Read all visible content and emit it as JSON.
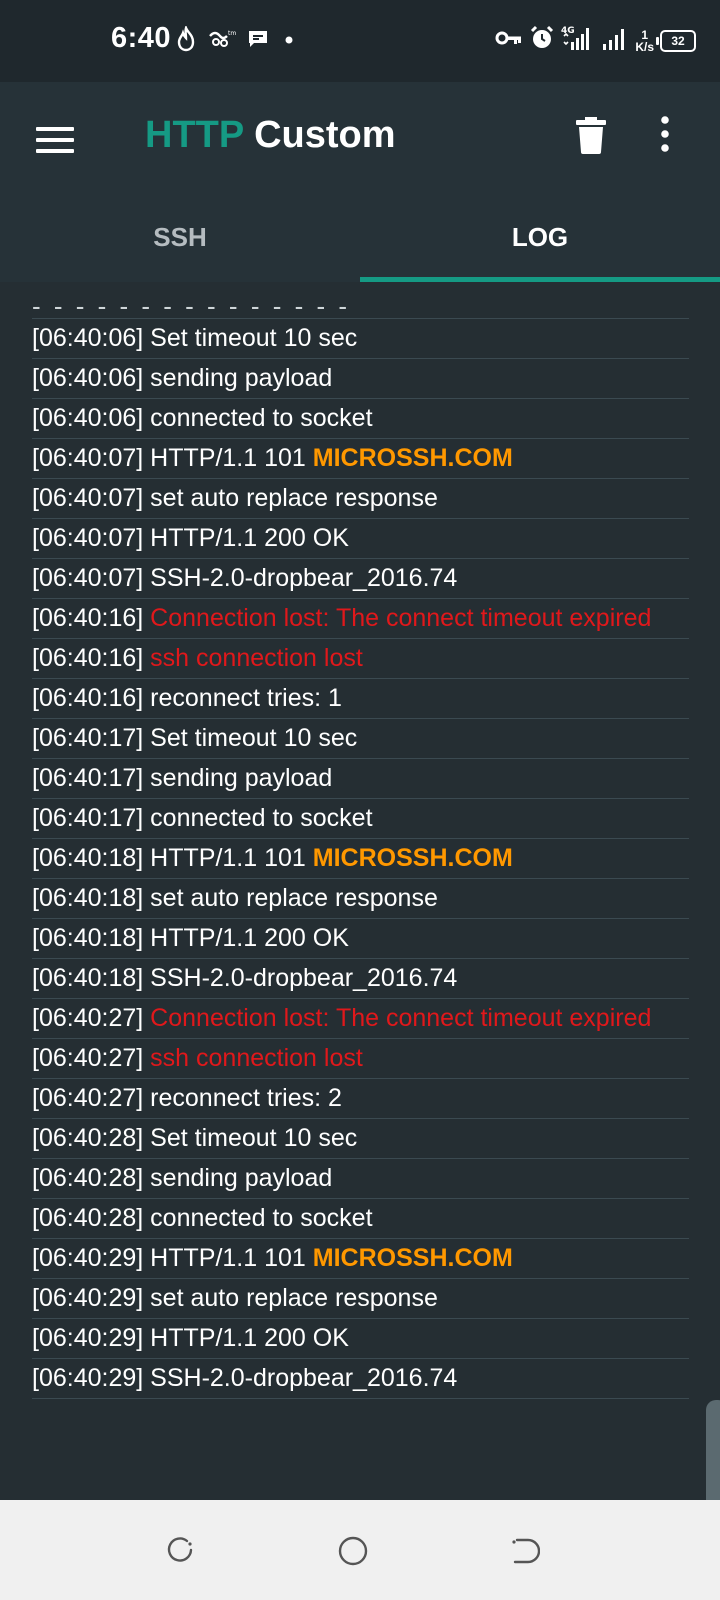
{
  "status_bar": {
    "time": "6:40",
    "network_type": "4G",
    "speed_value": "1",
    "speed_unit": "K/s",
    "battery": "32"
  },
  "app_bar": {
    "title_part1": "HTTP",
    "title_part2": "Custom",
    "icons": [
      "menu-icon",
      "trash-icon",
      "more-vert-icon"
    ]
  },
  "tabs": [
    {
      "label": "SSH",
      "active": false
    },
    {
      "label": "LOG",
      "active": true
    }
  ],
  "log": {
    "entries": [
      {
        "time": "[06:40:06]",
        "text": "Set timeout 10 sec",
        "style": "normal"
      },
      {
        "time": "[06:40:06]",
        "text": "sending payload",
        "style": "normal"
      },
      {
        "time": "[06:40:06]",
        "text": "connected to socket",
        "style": "normal"
      },
      {
        "time": "[06:40:07]",
        "text": "HTTP/1.1 101",
        "highlight": "MICROSSH.COM",
        "style": "normal"
      },
      {
        "time": "[06:40:07]",
        "text": "set auto replace response",
        "style": "normal"
      },
      {
        "time": "[06:40:07]",
        "text": "HTTP/1.1 200 OK",
        "style": "normal"
      },
      {
        "time": "[06:40:07]",
        "text": "SSH-2.0-dropbear_2016.74",
        "style": "normal"
      },
      {
        "time": "[06:40:16]",
        "text": "Connection lost: The connect timeout expired",
        "style": "error"
      },
      {
        "time": "[06:40:16]",
        "text": "ssh connection lost",
        "style": "error"
      },
      {
        "time": "[06:40:16]",
        "text": "reconnect tries: 1",
        "style": "normal"
      },
      {
        "time": "[06:40:17]",
        "text": "Set timeout 10 sec",
        "style": "normal"
      },
      {
        "time": "[06:40:17]",
        "text": "sending payload",
        "style": "normal"
      },
      {
        "time": "[06:40:17]",
        "text": "connected to socket",
        "style": "normal"
      },
      {
        "time": "[06:40:18]",
        "text": "HTTP/1.1 101",
        "highlight": "MICROSSH.COM",
        "style": "normal"
      },
      {
        "time": "[06:40:18]",
        "text": "set auto replace response",
        "style": "normal"
      },
      {
        "time": "[06:40:18]",
        "text": "HTTP/1.1 200 OK",
        "style": "normal"
      },
      {
        "time": "[06:40:18]",
        "text": "SSH-2.0-dropbear_2016.74",
        "style": "normal"
      },
      {
        "time": "[06:40:27]",
        "text": "Connection lost: The connect timeout expired",
        "style": "error"
      },
      {
        "time": "[06:40:27]",
        "text": "ssh connection lost",
        "style": "error"
      },
      {
        "time": "[06:40:27]",
        "text": "reconnect tries: 2",
        "style": "normal"
      },
      {
        "time": "[06:40:28]",
        "text": "Set timeout 10 sec",
        "style": "normal"
      },
      {
        "time": "[06:40:28]",
        "text": "sending payload",
        "style": "normal"
      },
      {
        "time": "[06:40:28]",
        "text": "connected to socket",
        "style": "normal"
      },
      {
        "time": "[06:40:29]",
        "text": "HTTP/1.1 101",
        "highlight": "MICROSSH.COM",
        "style": "normal"
      },
      {
        "time": "[06:40:29]",
        "text": "set auto replace response",
        "style": "normal"
      },
      {
        "time": "[06:40:29]",
        "text": "HTTP/1.1 200 OK",
        "style": "normal"
      },
      {
        "time": "[06:40:29]",
        "text": "SSH-2.0-dropbear_2016.74",
        "style": "normal"
      }
    ]
  },
  "colors": {
    "accent": "#159a84",
    "error": "#e0181b",
    "highlight": "#ff9800",
    "background": "#252e33"
  },
  "nav_bar": {
    "icons": [
      "recents-icon",
      "home-icon",
      "back-icon"
    ]
  }
}
